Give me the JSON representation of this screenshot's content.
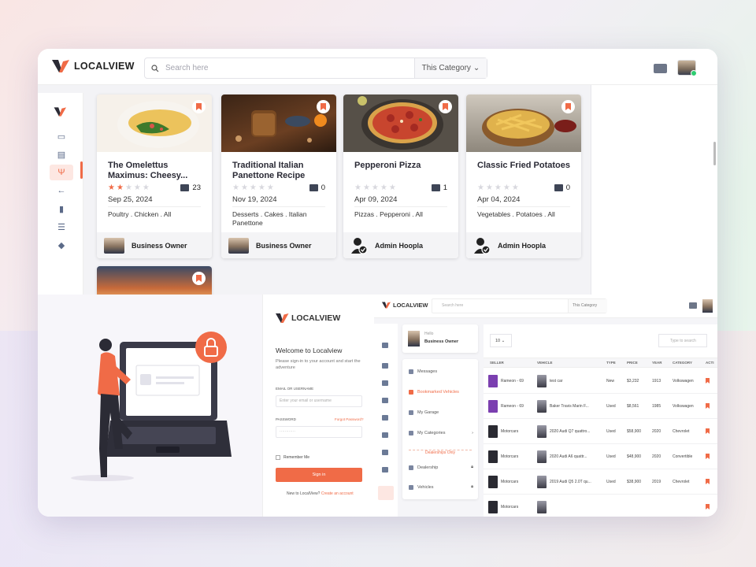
{
  "brand": {
    "name_a": "LOCAL",
    "name_b": "VIEW"
  },
  "search": {
    "placeholder": "Search here",
    "category": "This Category"
  },
  "cards": [
    {
      "title": "The Omelettus Maximus: Cheesy...",
      "rating": 2,
      "comments": "23",
      "date": "Sep 25, 2024",
      "tags": "Poultry . Chicken . All",
      "author": "Business Owner",
      "author_type": "photo"
    },
    {
      "title": "Traditional Italian Panettone Recipe",
      "rating": 0,
      "comments": "0",
      "date": "Nov 19, 2024",
      "tags": "Desserts . Cakes . Italian Panettone",
      "author": "Business Owner",
      "author_type": "photo"
    },
    {
      "title": "Pepperoni Pizza",
      "rating": 0,
      "comments": "1",
      "date": "Apr 09, 2024",
      "tags": "Pizzas . Pepperoni . All",
      "author": "Admin Hoopla",
      "author_type": "admin"
    },
    {
      "title": "Classic Fried Potatoes",
      "rating": 0,
      "comments": "0",
      "date": "Apr 04, 2024",
      "tags": "Vegetables . Potatoes . All",
      "author": "Admin Hoopla",
      "author_type": "admin"
    }
  ],
  "login": {
    "welcome": "Welcome to Localview",
    "subtitle": "Please sign-in to your account and start the adventure",
    "email_label": "EMAIL OR USERNAME",
    "email_placeholder": "Enter your email or username",
    "password_label": "PASSWORD",
    "forgot": "Forgot Password?",
    "password_placeholder": "············",
    "remember": "Remember Me",
    "signin": "Sign in",
    "new_text": "New to LocalView?",
    "create": "Create an account"
  },
  "dash": {
    "search_placeholder": "Search here",
    "category": "This Category",
    "profile_hello": "Hello",
    "profile_role": "Business Owner",
    "menu": [
      "Messages",
      "Bookmarked Vehicles",
      "My Garage",
      "My Categories"
    ],
    "dealership_divider": "Dealerships Only",
    "dealer_menu": [
      "Dealership",
      "Vehicles"
    ],
    "per_page": "10",
    "table_search": "Type to search",
    "headers": [
      "SELLER",
      "VEHICLE",
      "TYPE",
      "PRICE",
      "YEAR",
      "CATEGORY",
      "ACTI"
    ],
    "rows": [
      {
        "seller": "Rameon - 69",
        "vehicle": "test car",
        "type": "New",
        "price": "$3,232",
        "year": "1913",
        "category": "Volkswagen",
        "seller_color": "#7b3fb0"
      },
      {
        "seller": "Rameon - 69",
        "vehicle": "Baker Travis Marin F...",
        "type": "Used",
        "price": "$8,561",
        "year": "1985",
        "category": "Volkswagen",
        "seller_color": "#7b3fb0"
      },
      {
        "seller": "Motorcars",
        "vehicle": "2020 Audi Q7 quattro...",
        "type": "Used",
        "price": "$58,900",
        "year": "2020",
        "category": "Chevrolet",
        "seller_color": "#2a2a32"
      },
      {
        "seller": "Motorcars",
        "vehicle": "2020 Audi A6 quattr...",
        "type": "Used",
        "price": "$48,900",
        "year": "2020",
        "category": "Convertible",
        "seller_color": "#2a2a32"
      },
      {
        "seller": "Motorcars",
        "vehicle": "2019 Audi Q5 2.0T qu...",
        "type": "Used",
        "price": "$38,900",
        "year": "2019",
        "category": "Chevrolet",
        "seller_color": "#2a2a32"
      },
      {
        "seller": "Motorcars",
        "vehicle": "",
        "type": "",
        "price": "",
        "year": "",
        "category": "",
        "seller_color": "#2a2a32"
      }
    ]
  },
  "colors": {
    "accent": "#f06b47",
    "navy": "#3e4556",
    "sidebar_icon": "#5b6a88"
  }
}
